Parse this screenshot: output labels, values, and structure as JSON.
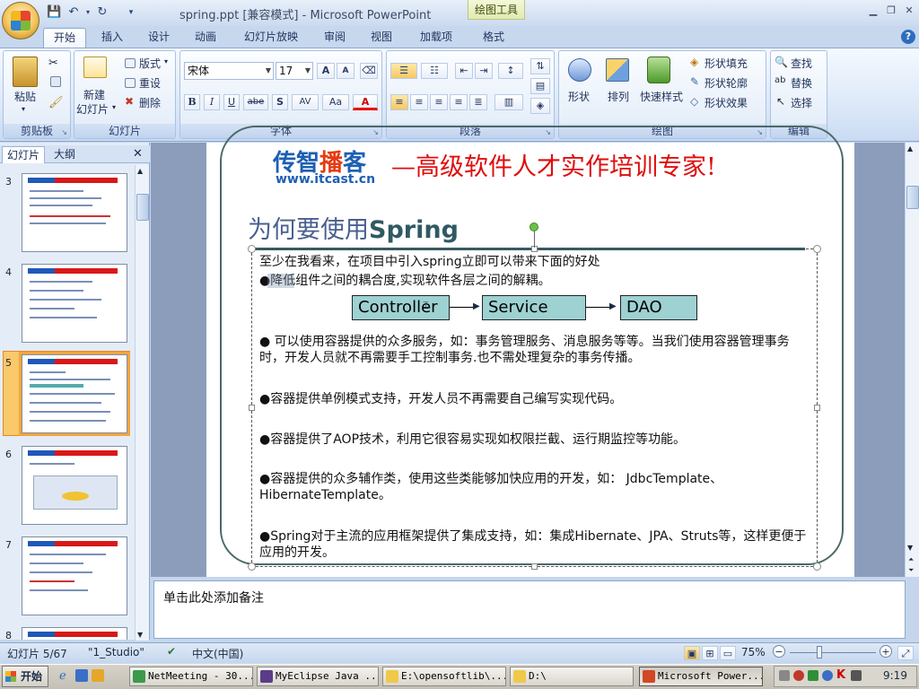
{
  "window": {
    "title": "spring.ppt [兼容模式] - Microsoft PowerPoint",
    "context_tab_group": "绘图工具"
  },
  "tabs": [
    "开始",
    "插入",
    "设计",
    "动画",
    "幻灯片放映",
    "审阅",
    "视图",
    "加载项",
    "格式"
  ],
  "ribbon": {
    "clipboard": {
      "label": "剪贴板",
      "paste": "粘贴"
    },
    "slides": {
      "label": "幻灯片",
      "new_slide_1": "新建",
      "new_slide_2": "幻灯片",
      "layout": "版式",
      "reset": "重设",
      "delete": "删除"
    },
    "font": {
      "label": "字体",
      "name": "宋体",
      "size": "17",
      "grow": "A",
      "shrink": "A",
      "bold": "B",
      "italic": "I",
      "underline": "U",
      "strike": "abe",
      "shadow": "S",
      "spacing": "AV",
      "case": "Aa",
      "color": "A"
    },
    "paragraph": {
      "label": "段落"
    },
    "drawing": {
      "label": "绘图",
      "shapes": "形状",
      "arrange": "排列",
      "quick_styles": "快速样式",
      "fill": "形状填充",
      "outline": "形状轮廓",
      "effects": "形状效果"
    },
    "editing": {
      "label": "编辑",
      "find": "查找",
      "replace": "替换",
      "select": "选择"
    }
  },
  "left_pane": {
    "tab_slides": "幻灯片",
    "tab_outline": "大纲",
    "thumbnails": [
      "3",
      "4",
      "5",
      "6",
      "7",
      "8"
    ],
    "selected": "5"
  },
  "slide": {
    "logo_1": "传智",
    "logo_2": "播",
    "logo_3": "客",
    "logo_url": "www.itcast.cn",
    "banner": "—高级软件人才实作培训专家!",
    "title_prefix": "为何要使用",
    "title_bold": "Spring",
    "intro": "至少在我看来，在项目中引入spring立即可以带来下面的好处",
    "bullet1": "●降低组件之间的耦合度,实现软件各层之间的解耦。",
    "diagram": [
      "Controller",
      "Service",
      "DAO"
    ],
    "bullet2": "●  可以使用容器提供的众多服务，如：事务管理服务、消息服务等等。当我们使用容器管理事务时，开发人员就不再需要手工控制事务.也不需处理复杂的事务传播。",
    "bullet3": "●容器提供单例模式支持，开发人员不再需要自己编写实现代码。",
    "bullet4": "●容器提供了AOP技术，利用它很容易实现如权限拦截、运行期监控等功能。",
    "bullet5": "●容器提供的众多辅作类，使用这些类能够加快应用的开发，如： JdbcTemplate、HibernateTemplate。",
    "bullet6": "●Spring对于主流的应用框架提供了集成支持，如：集成Hibernate、JPA、Struts等，这样更便于应用的开发。"
  },
  "notes": {
    "placeholder": "单击此处添加备注"
  },
  "status": {
    "slide_info": "幻灯片 5/67",
    "theme": "\"1_Studio\"",
    "language": "中文(中国)",
    "zoom": "75%"
  },
  "taskbar": {
    "start": "开始",
    "tasks": [
      "NetMeeting - 30...",
      "MyEclipse Java ...",
      "E:\\opensoftlib\\...",
      "D:\\",
      "Microsoft Power..."
    ],
    "clock": "9:19"
  }
}
